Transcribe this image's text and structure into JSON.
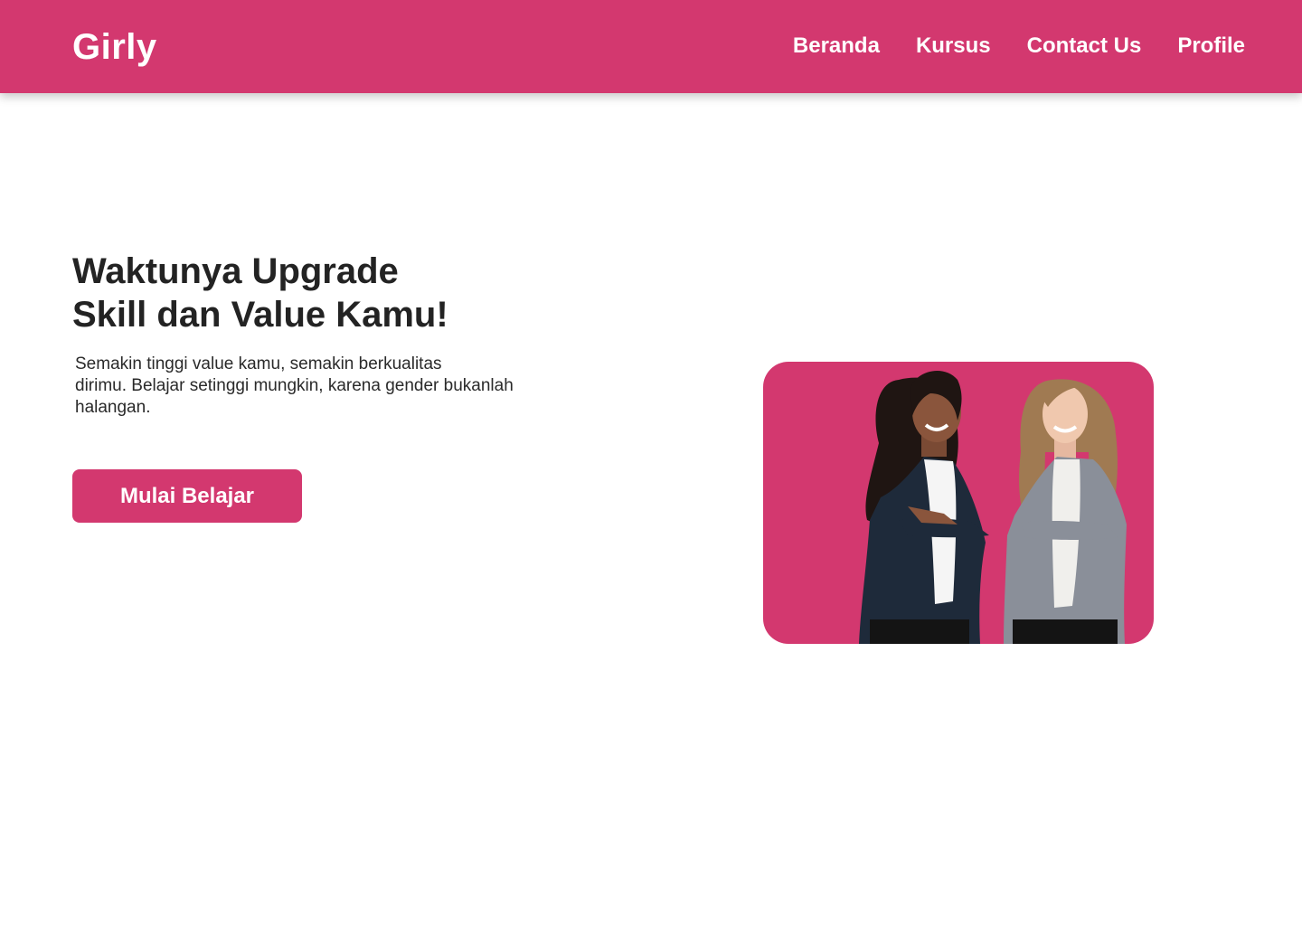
{
  "brand": "Girly",
  "nav": {
    "items": [
      "Beranda",
      "Kursus",
      "Contact Us",
      "Profile"
    ]
  },
  "hero": {
    "title_lines": [
      "Waktunya Upgrade",
      "Skill dan Value Kamu!"
    ],
    "description_lines": [
      "Semakin tinggi value kamu, semakin berkualitas",
      "dirimu. Belajar setinggi mungkin, karena gender bukanlah",
      "halangan."
    ],
    "cta_label": "Mulai Belajar",
    "image": "two-businesswomen-arms-crossed"
  },
  "colors": {
    "primary": "#d3386f",
    "heading": "#232323",
    "text": "#2a2a2a",
    "background": "#ffffff"
  }
}
